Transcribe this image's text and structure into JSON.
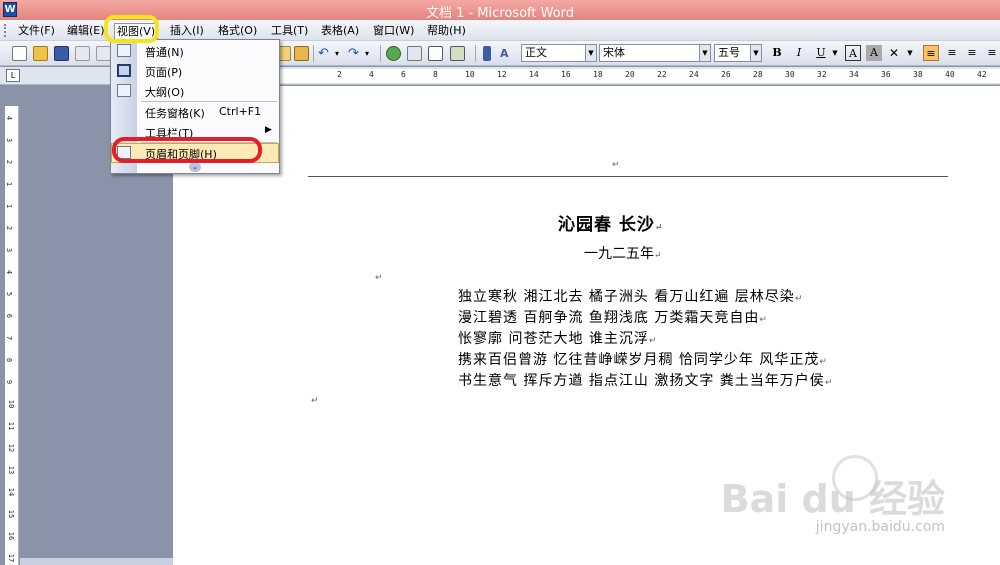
{
  "window": {
    "title": "文档 1 - Microsoft Word",
    "app_icon": "W"
  },
  "menubar": {
    "items": [
      "文件(F)",
      "编辑(E)",
      "视图(V)",
      "插入(I)",
      "格式(O)",
      "工具(T)",
      "表格(A)",
      "窗口(W)",
      "帮助(H)"
    ],
    "active": "视图(V)"
  },
  "toolbar": {
    "style": "正文",
    "font": "宋体",
    "size": "五号",
    "bold": "B",
    "italic": "I",
    "underline": "U",
    "char_border": "A",
    "char_shade": "A"
  },
  "ruler": {
    "corner": "L",
    "h_labels": [
      "2",
      "4",
      "6",
      "8",
      "10",
      "12",
      "14",
      "16",
      "18",
      "20",
      "22",
      "24",
      "26",
      "28",
      "30",
      "32",
      "34",
      "36",
      "38",
      "40",
      "42"
    ],
    "v_labels": [
      "4",
      "3",
      "2",
      "1",
      "1",
      "2",
      "3",
      "4",
      "5",
      "6",
      "7",
      "8",
      "9",
      "10",
      "11",
      "12",
      "13",
      "14",
      "15",
      "16",
      "17"
    ]
  },
  "view_menu": {
    "items": [
      {
        "label": "普通(N)",
        "shortcut": "",
        "submenu": false,
        "icon": "normal-view-icon"
      },
      {
        "label": "页面(P)",
        "shortcut": "",
        "submenu": false,
        "icon": "page-view-icon"
      },
      {
        "label": "大纲(O)",
        "shortcut": "",
        "submenu": false,
        "icon": "outline-view-icon"
      },
      {
        "label": "任务窗格(K)",
        "shortcut": "Ctrl+F1",
        "submenu": false,
        "icon": ""
      },
      {
        "label": "工具栏(T)",
        "shortcut": "",
        "submenu": true,
        "icon": ""
      },
      {
        "label": "页眉和页脚(H)",
        "shortcut": "",
        "submenu": false,
        "icon": "header-footer-icon"
      }
    ],
    "submenu_arrow": "▶",
    "expand_arrow": "⌄"
  },
  "document": {
    "paragraph_mark": "↵",
    "title": "沁园春  长沙",
    "subtitle": "一九二五年",
    "lines": [
      "独立寒秋  湘江北去  橘子洲头  看万山红遍  层林尽染",
      "漫江碧透  百舸争流  鱼翔浅底  万类霜天竞自由",
      "怅寥廓  问苍茫大地  谁主沉浮",
      "携来百侣曾游  忆往昔峥嵘岁月稠  恰同学少年  风华正茂",
      "书生意气  挥斥方遒  指点江山  激扬文字  粪土当年万户侯"
    ]
  },
  "watermark": {
    "brand": "Bai du 经验",
    "url": "jingyan.baidu.com"
  },
  "colors": {
    "titlebar": "#e4837e",
    "highlight_yellow": "#f5e31c",
    "highlight_red": "#e21e2a",
    "menu_hover": "#ffe9b5"
  }
}
